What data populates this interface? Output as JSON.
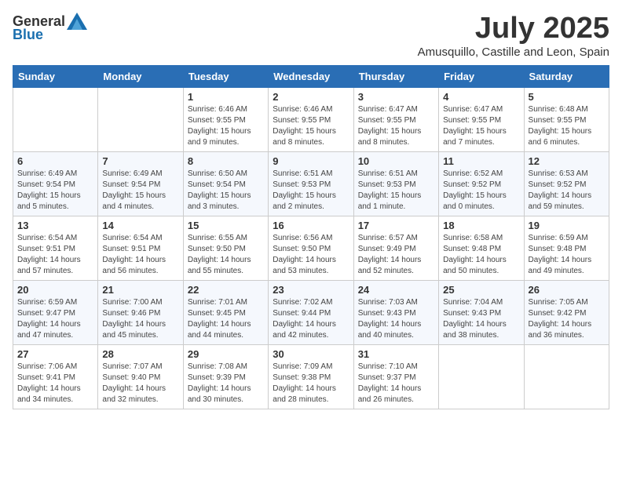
{
  "header": {
    "logo_general": "General",
    "logo_blue": "Blue",
    "month_title": "July 2025",
    "location": "Amusquillo, Castille and Leon, Spain"
  },
  "calendar": {
    "days_of_week": [
      "Sunday",
      "Monday",
      "Tuesday",
      "Wednesday",
      "Thursday",
      "Friday",
      "Saturday"
    ],
    "weeks": [
      [
        {
          "day": "",
          "info": ""
        },
        {
          "day": "",
          "info": ""
        },
        {
          "day": "1",
          "info": "Sunrise: 6:46 AM\nSunset: 9:55 PM\nDaylight: 15 hours and 9 minutes."
        },
        {
          "day": "2",
          "info": "Sunrise: 6:46 AM\nSunset: 9:55 PM\nDaylight: 15 hours and 8 minutes."
        },
        {
          "day": "3",
          "info": "Sunrise: 6:47 AM\nSunset: 9:55 PM\nDaylight: 15 hours and 8 minutes."
        },
        {
          "day": "4",
          "info": "Sunrise: 6:47 AM\nSunset: 9:55 PM\nDaylight: 15 hours and 7 minutes."
        },
        {
          "day": "5",
          "info": "Sunrise: 6:48 AM\nSunset: 9:55 PM\nDaylight: 15 hours and 6 minutes."
        }
      ],
      [
        {
          "day": "6",
          "info": "Sunrise: 6:49 AM\nSunset: 9:54 PM\nDaylight: 15 hours and 5 minutes."
        },
        {
          "day": "7",
          "info": "Sunrise: 6:49 AM\nSunset: 9:54 PM\nDaylight: 15 hours and 4 minutes."
        },
        {
          "day": "8",
          "info": "Sunrise: 6:50 AM\nSunset: 9:54 PM\nDaylight: 15 hours and 3 minutes."
        },
        {
          "day": "9",
          "info": "Sunrise: 6:51 AM\nSunset: 9:53 PM\nDaylight: 15 hours and 2 minutes."
        },
        {
          "day": "10",
          "info": "Sunrise: 6:51 AM\nSunset: 9:53 PM\nDaylight: 15 hours and 1 minute."
        },
        {
          "day": "11",
          "info": "Sunrise: 6:52 AM\nSunset: 9:52 PM\nDaylight: 15 hours and 0 minutes."
        },
        {
          "day": "12",
          "info": "Sunrise: 6:53 AM\nSunset: 9:52 PM\nDaylight: 14 hours and 59 minutes."
        }
      ],
      [
        {
          "day": "13",
          "info": "Sunrise: 6:54 AM\nSunset: 9:51 PM\nDaylight: 14 hours and 57 minutes."
        },
        {
          "day": "14",
          "info": "Sunrise: 6:54 AM\nSunset: 9:51 PM\nDaylight: 14 hours and 56 minutes."
        },
        {
          "day": "15",
          "info": "Sunrise: 6:55 AM\nSunset: 9:50 PM\nDaylight: 14 hours and 55 minutes."
        },
        {
          "day": "16",
          "info": "Sunrise: 6:56 AM\nSunset: 9:50 PM\nDaylight: 14 hours and 53 minutes."
        },
        {
          "day": "17",
          "info": "Sunrise: 6:57 AM\nSunset: 9:49 PM\nDaylight: 14 hours and 52 minutes."
        },
        {
          "day": "18",
          "info": "Sunrise: 6:58 AM\nSunset: 9:48 PM\nDaylight: 14 hours and 50 minutes."
        },
        {
          "day": "19",
          "info": "Sunrise: 6:59 AM\nSunset: 9:48 PM\nDaylight: 14 hours and 49 minutes."
        }
      ],
      [
        {
          "day": "20",
          "info": "Sunrise: 6:59 AM\nSunset: 9:47 PM\nDaylight: 14 hours and 47 minutes."
        },
        {
          "day": "21",
          "info": "Sunrise: 7:00 AM\nSunset: 9:46 PM\nDaylight: 14 hours and 45 minutes."
        },
        {
          "day": "22",
          "info": "Sunrise: 7:01 AM\nSunset: 9:45 PM\nDaylight: 14 hours and 44 minutes."
        },
        {
          "day": "23",
          "info": "Sunrise: 7:02 AM\nSunset: 9:44 PM\nDaylight: 14 hours and 42 minutes."
        },
        {
          "day": "24",
          "info": "Sunrise: 7:03 AM\nSunset: 9:43 PM\nDaylight: 14 hours and 40 minutes."
        },
        {
          "day": "25",
          "info": "Sunrise: 7:04 AM\nSunset: 9:43 PM\nDaylight: 14 hours and 38 minutes."
        },
        {
          "day": "26",
          "info": "Sunrise: 7:05 AM\nSunset: 9:42 PM\nDaylight: 14 hours and 36 minutes."
        }
      ],
      [
        {
          "day": "27",
          "info": "Sunrise: 7:06 AM\nSunset: 9:41 PM\nDaylight: 14 hours and 34 minutes."
        },
        {
          "day": "28",
          "info": "Sunrise: 7:07 AM\nSunset: 9:40 PM\nDaylight: 14 hours and 32 minutes."
        },
        {
          "day": "29",
          "info": "Sunrise: 7:08 AM\nSunset: 9:39 PM\nDaylight: 14 hours and 30 minutes."
        },
        {
          "day": "30",
          "info": "Sunrise: 7:09 AM\nSunset: 9:38 PM\nDaylight: 14 hours and 28 minutes."
        },
        {
          "day": "31",
          "info": "Sunrise: 7:10 AM\nSunset: 9:37 PM\nDaylight: 14 hours and 26 minutes."
        },
        {
          "day": "",
          "info": ""
        },
        {
          "day": "",
          "info": ""
        }
      ]
    ]
  }
}
